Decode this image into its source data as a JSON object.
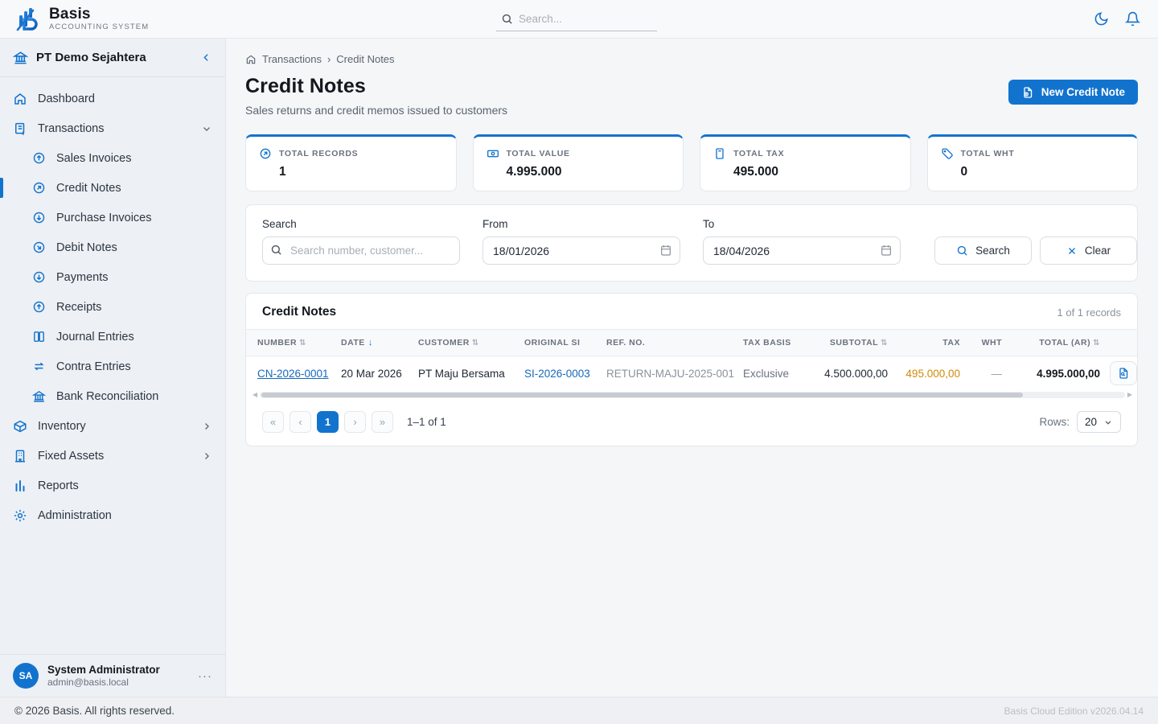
{
  "app": {
    "name": "Basis",
    "tagline": "ACCOUNTING SYSTEM",
    "copyright": "© 2026 Basis. All rights reserved.",
    "version": "Basis Cloud Edition v2026.04.14"
  },
  "topbar": {
    "search_placeholder": "Search..."
  },
  "sidebar": {
    "company": "PT Demo Sejahtera",
    "nav": [
      {
        "label": "Dashboard"
      },
      {
        "label": "Transactions"
      },
      {
        "label": "Sales Invoices"
      },
      {
        "label": "Credit Notes"
      },
      {
        "label": "Purchase Invoices"
      },
      {
        "label": "Debit Notes"
      },
      {
        "label": "Payments"
      },
      {
        "label": "Receipts"
      },
      {
        "label": "Journal Entries"
      },
      {
        "label": "Contra Entries"
      },
      {
        "label": "Bank Reconciliation"
      },
      {
        "label": "Inventory"
      },
      {
        "label": "Fixed Assets"
      },
      {
        "label": "Reports"
      },
      {
        "label": "Administration"
      }
    ],
    "user": {
      "initials": "SA",
      "name": "System Administrator",
      "email": "admin@basis.local",
      "menu": "···"
    }
  },
  "breadcrumb": {
    "first": "Transactions",
    "sep": "›",
    "second": "Credit Notes"
  },
  "page": {
    "title": "Credit Notes",
    "subtitle": "Sales returns and credit memos issued to customers",
    "new_button": "New Credit Note"
  },
  "stats": [
    {
      "label": "TOTAL RECORDS",
      "value": "1"
    },
    {
      "label": "TOTAL VALUE",
      "value": "4.995.000"
    },
    {
      "label": "TOTAL TAX",
      "value": "495.000"
    },
    {
      "label": "TOTAL WHT",
      "value": "0"
    }
  ],
  "filters": {
    "search_label": "Search",
    "search_placeholder": "Search number, customer...",
    "from_label": "From",
    "from_value": "18/01/2026",
    "to_label": "To",
    "to_value": "18/04/2026",
    "search_button": "Search",
    "clear_button": "Clear"
  },
  "table": {
    "title": "Credit Notes",
    "records_text": "1 of 1 records",
    "columns": [
      {
        "label": "NUMBER",
        "sort": "⇅"
      },
      {
        "label": "DATE",
        "sort": "↓"
      },
      {
        "label": "CUSTOMER",
        "sort": "⇅"
      },
      {
        "label": "ORIGINAL SI"
      },
      {
        "label": "REF. NO."
      },
      {
        "label": "TAX BASIS"
      },
      {
        "label": "SUBTOTAL",
        "sort": "⇅"
      },
      {
        "label": "TAX"
      },
      {
        "label": "WHT"
      },
      {
        "label": "TOTAL (AR)",
        "sort": "⇅"
      }
    ],
    "rows": [
      {
        "number": "CN-2026-0001",
        "date": "20 Mar 2026",
        "customer": "PT Maju Bersama",
        "original_si": "SI-2026-0003",
        "ref_no": "RETURN-MAJU-2025-001",
        "tax_basis": "Exclusive",
        "subtotal": "4.500.000,00",
        "tax": "495.000,00",
        "wht": "—",
        "total": "4.995.000,00"
      }
    ],
    "pagination": {
      "first": "«",
      "prev": "‹",
      "page": "1",
      "next": "›",
      "last": "»",
      "info": "1–1 of 1",
      "rows_label": "Rows:",
      "rows_value": "20"
    }
  },
  "colors": {
    "primary": "#1273ce",
    "link": "#1569bd",
    "tax_amount": "#d18a0b"
  }
}
